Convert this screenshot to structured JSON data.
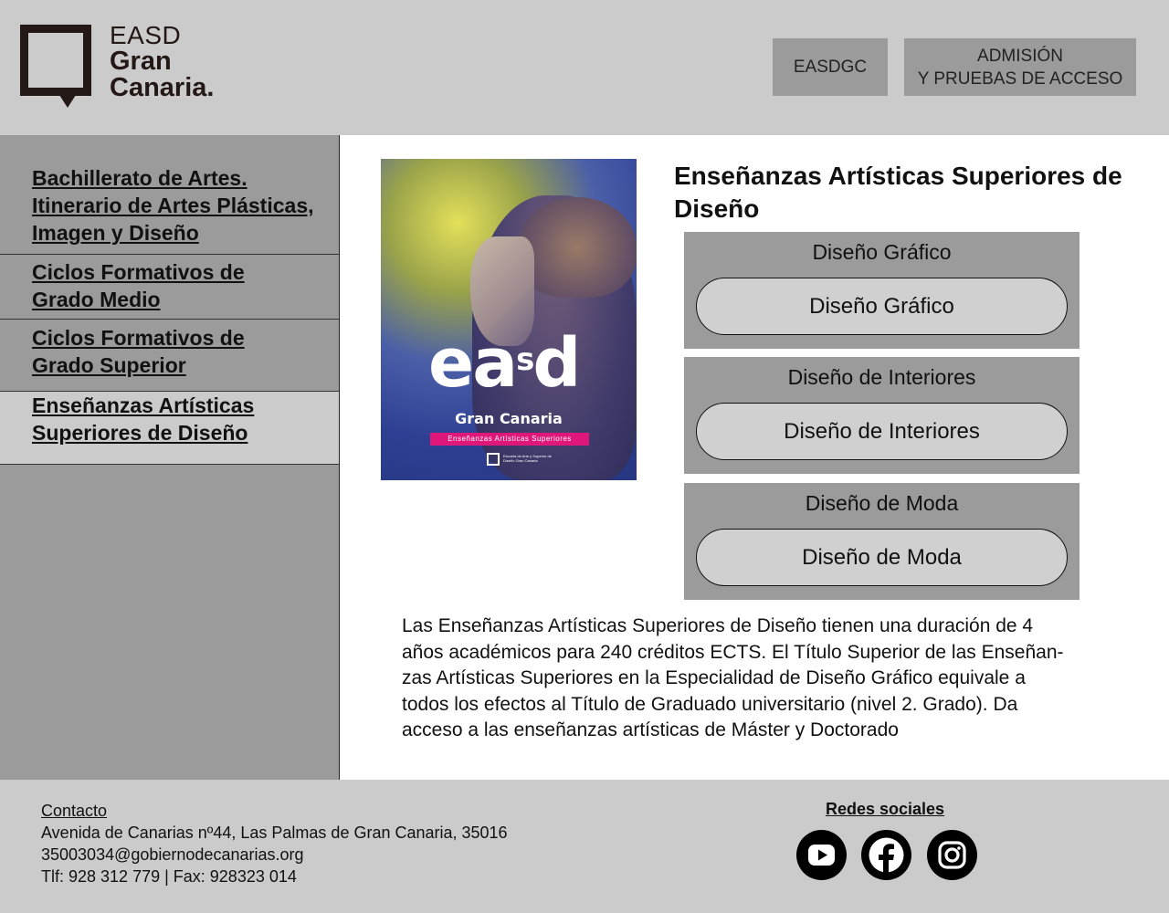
{
  "logo": {
    "line1": "EASD",
    "line2": "Gran",
    "line3": "Canaria."
  },
  "header": {
    "btn_easdgc": "EASDGC",
    "btn_admision_line1": "ADMISIÓN",
    "btn_admision_line2": "Y PRUEBAS DE ACCESO"
  },
  "sidebar": {
    "items": [
      {
        "lines": [
          "Bachillerato de Artes.",
          "Itinerario de Artes Plásticas,",
          "Imagen y Diseño"
        ]
      },
      {
        "lines": [
          "Ciclos Formativos de",
          "Grado Medio"
        ]
      },
      {
        "lines": [
          "Ciclos Formativos de",
          "Grado Superior"
        ]
      },
      {
        "lines": [
          "Enseñanzas Artísticas",
          "Superiores de Diseño"
        ],
        "active": true
      }
    ]
  },
  "poster": {
    "brand_e": "ea",
    "brand_s": "s",
    "brand_d": "d",
    "brand_gc": "Gran Canaria",
    "band": "Enseñanzas Artísticas Superiores",
    "mini": "Escuela de Arte y Superior de Diseño Gran Canaria"
  },
  "main": {
    "title": "Enseñanzas Artísticas Superiores de Diseño",
    "groups": [
      {
        "label": "Diseño Gráfico",
        "button": "Diseño Gráfico"
      },
      {
        "label": "Diseño de Interiores",
        "button": "Diseño de Interiores"
      },
      {
        "label": "Diseño de Moda",
        "button": "Diseño de Moda"
      }
    ],
    "description_lines": [
      "Las Enseñanzas Artísticas Superiores de Diseño tienen una duración de 4",
      "años académicos para 240 créditos ECTS. El Título Superior de las Enseñan-",
      "zas Artísticas Superiores en la Especialidad de Diseño Gráfico equivale a",
      "todos los efectos al Título de Graduado universitario (nivel 2. Grado). Da",
      "acceso a las enseñanzas artísticas de Máster y Doctorado"
    ]
  },
  "footer": {
    "contact_title": "Contacto",
    "address": "Avenida de Canarias nº44, Las Palmas de Gran Canaria, 35016",
    "email": "35003034@gobiernodecanarias.org",
    "phone": "Tlf: 928 312 779 | Fax: 928323 014",
    "social_title": "Redes sociales",
    "social_icons": [
      "youtube-icon",
      "facebook-icon",
      "instagram-icon"
    ]
  },
  "colors": {
    "header_bg": "#cbcbcb",
    "sidebar_bg": "#9b9b9b",
    "button_bg": "#9b9b9b",
    "pill_bg": "#d0d0d0",
    "accent_pink": "#e0177a"
  }
}
